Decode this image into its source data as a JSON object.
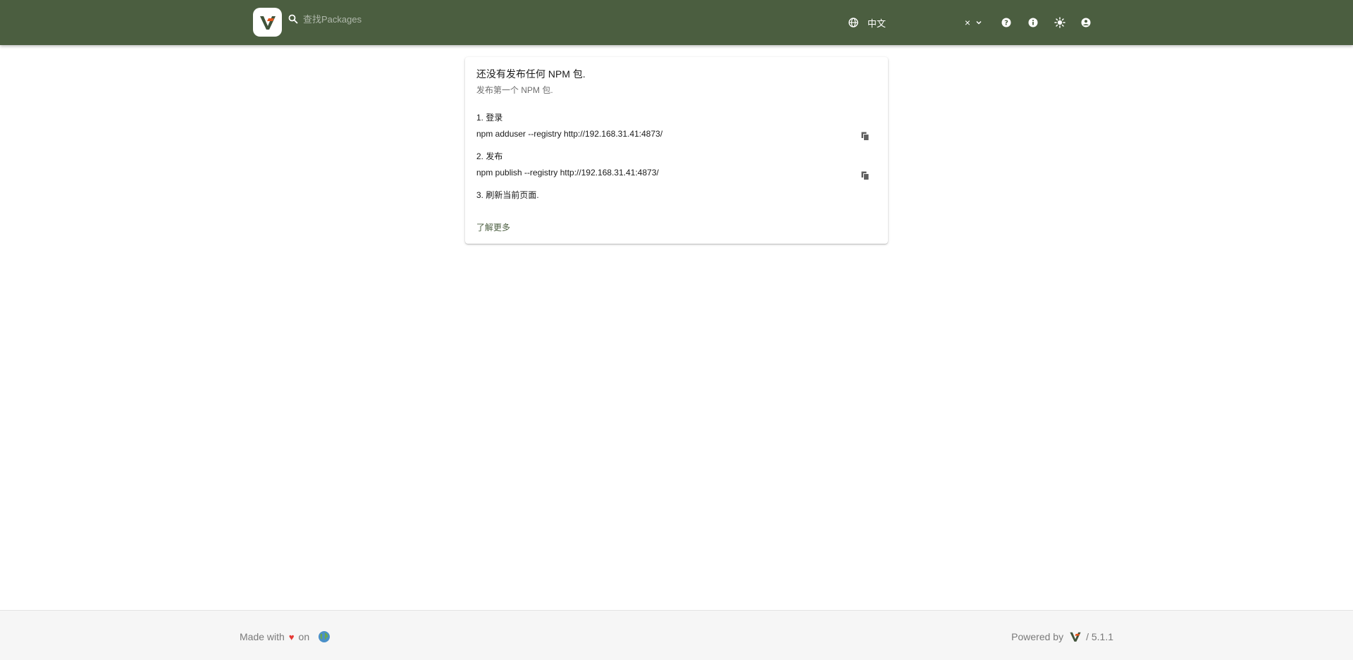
{
  "header": {
    "search_placeholder": "查找Packages",
    "language_value": "中文",
    "language_clear": "×",
    "icons": [
      "search-icon",
      "globe-icon",
      "chevron-down-icon",
      "help-icon",
      "info-icon",
      "sun-icon",
      "account-icon"
    ],
    "background_color": "#4b5e40"
  },
  "card": {
    "title": "还没有发布任何 NPM 包.",
    "subtitle": "发布第一个 NPM 包.",
    "steps": [
      {
        "label": "1. 登录",
        "command": "npm adduser --registry http://192.168.31.41:4873/"
      },
      {
        "label": "2. 发布",
        "command": "npm publish --registry http://192.168.31.41:4873/"
      },
      {
        "label": "3. 刷新当前页面."
      }
    ],
    "learn_more": "了解更多"
  },
  "footer": {
    "made_with": "Made with",
    "heart": "♥",
    "on": "on",
    "powered_by": "Powered by",
    "version": "/ 5.1.1"
  },
  "colors": {
    "brand_green": "#4b5e40",
    "heart_red": "#e53935"
  }
}
